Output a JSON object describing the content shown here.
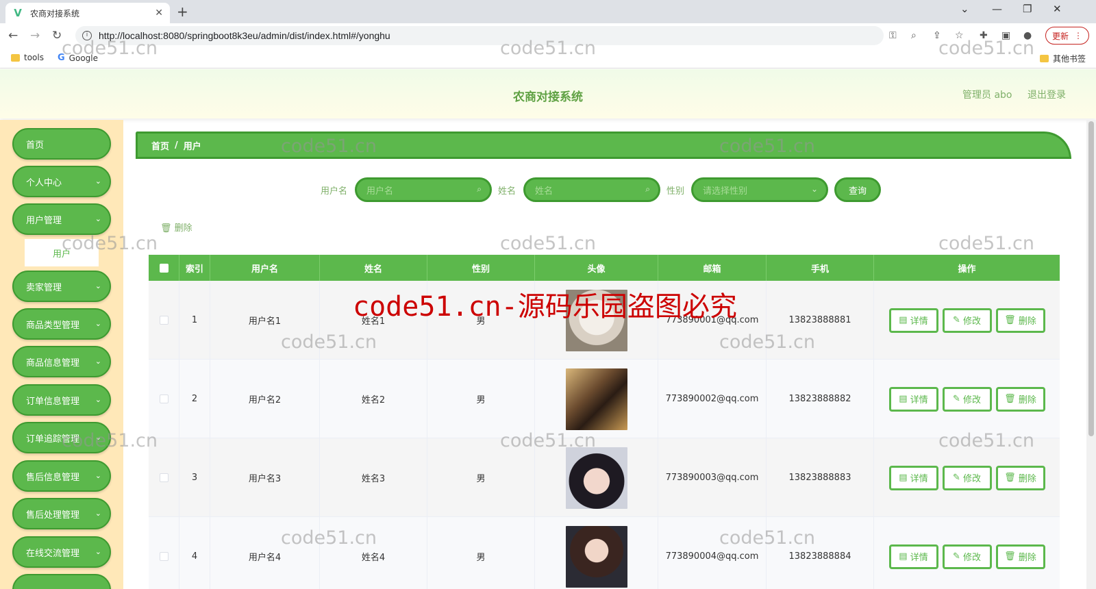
{
  "browser": {
    "tab_title": "农商对接系统",
    "url": "http://localhost:8080/springboot8k3eu/admin/dist/index.html#/yonghu",
    "update_label": "更新",
    "bookmarks": [
      "tools",
      "Google"
    ],
    "other_bookmarks": "其他书签"
  },
  "header": {
    "title": "农商对接系统",
    "admin_label": "管理员 abo",
    "logout_label": "退出登录"
  },
  "sidebar": {
    "items": [
      {
        "label": "首页",
        "has_children": false
      },
      {
        "label": "个人中心",
        "has_children": true
      },
      {
        "label": "用户管理",
        "has_children": true
      },
      {
        "label": "卖家管理",
        "has_children": true
      },
      {
        "label": "商品类型管理",
        "has_children": true
      },
      {
        "label": "商品信息管理",
        "has_children": true
      },
      {
        "label": "订单信息管理",
        "has_children": true
      },
      {
        "label": "订单追踪管理",
        "has_children": true
      },
      {
        "label": "售后信息管理",
        "has_children": true
      },
      {
        "label": "售后处理管理",
        "has_children": true
      },
      {
        "label": "在线交流管理",
        "has_children": true
      }
    ],
    "submenu": "用户"
  },
  "breadcrumb": {
    "home": "首页",
    "sep": "/",
    "current": "用户"
  },
  "search": {
    "username_label": "用户名",
    "username_placeholder": "用户名",
    "name_label": "姓名",
    "name_placeholder": "姓名",
    "gender_label": "性别",
    "gender_placeholder": "请选择性别",
    "query_label": "查询"
  },
  "batch_delete_label": "删除",
  "table": {
    "columns": [
      "索引",
      "用户名",
      "姓名",
      "性别",
      "头像",
      "邮箱",
      "手机",
      "操作"
    ],
    "rows": [
      {
        "index": "1",
        "username": "用户名1",
        "name": "姓名1",
        "gender": "男",
        "email": "773890001@qq.com",
        "phone": "13823888881",
        "avatar": "cat-avatar"
      },
      {
        "index": "2",
        "username": "用户名2",
        "name": "姓名2",
        "gender": "男",
        "email": "773890002@qq.com",
        "phone": "13823888882",
        "avatar": "girl-avatar-1"
      },
      {
        "index": "3",
        "username": "用户名3",
        "name": "姓名3",
        "gender": "男",
        "email": "773890003@qq.com",
        "phone": "13823888883",
        "avatar": "girl-avatar-2"
      },
      {
        "index": "4",
        "username": "用户名4",
        "name": "姓名4",
        "gender": "男",
        "email": "773890004@qq.com",
        "phone": "13823888884",
        "avatar": "girl-avatar-3"
      }
    ],
    "actions": {
      "detail": "详情",
      "edit": "修改",
      "delete": "删除"
    }
  },
  "watermark": {
    "small": "code51.cn",
    "big": "code51.cn-源码乐园盗图必究"
  },
  "colors": {
    "primary": "#5cb84c",
    "primary_dark": "#3e9a30",
    "sidebar_bg": "#ffe8b8"
  }
}
